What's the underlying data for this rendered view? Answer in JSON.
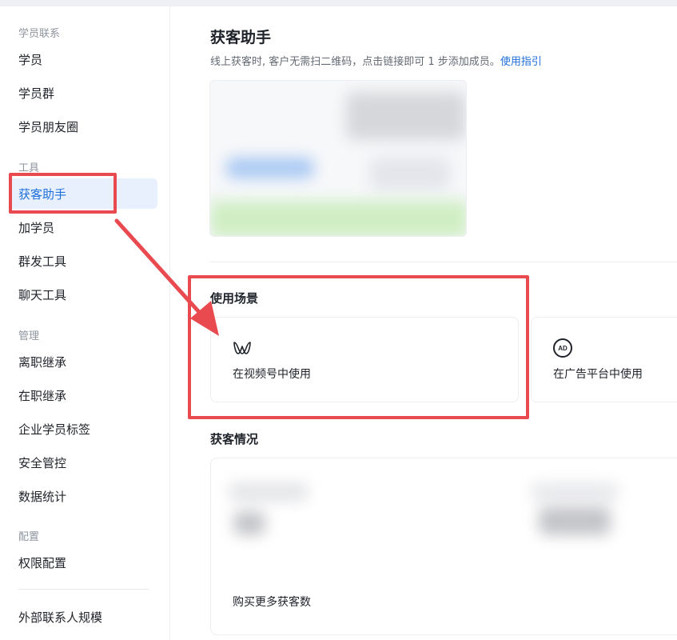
{
  "sidebar": {
    "sections": [
      {
        "title": "学员联系",
        "items": [
          "学员",
          "学员群",
          "学员朋友圈"
        ]
      },
      {
        "title": "工具",
        "items": [
          "获客助手",
          "加学员",
          "群发工具",
          "聊天工具"
        ]
      },
      {
        "title": "管理",
        "items": [
          "离职继承",
          "在职继承",
          "企业学员标签",
          "安全管控",
          "数据统计"
        ]
      },
      {
        "title": "配置",
        "items": [
          "权限配置"
        ]
      }
    ],
    "footer_item": "外部联系人规模",
    "active_item": "获客助手"
  },
  "main": {
    "title": "获客助手",
    "subtitle": "线上获客时, 客户无需扫二维码，点击链接即可 1 步添加成员。",
    "guide_link": "使用指引",
    "scenes_title": "使用场景",
    "scenes": [
      {
        "label": "在视频号中使用",
        "icon": "channels-icon"
      },
      {
        "label": "在广告平台中使用",
        "icon": "ad-icon",
        "icon_text": "AD"
      }
    ],
    "stats_title": "获客情况",
    "buy_more": "购买更多获客数"
  },
  "colors": {
    "accent": "#1e6fd9",
    "annotation": "#e84a4f",
    "active_bg": "#e8f0fe"
  }
}
